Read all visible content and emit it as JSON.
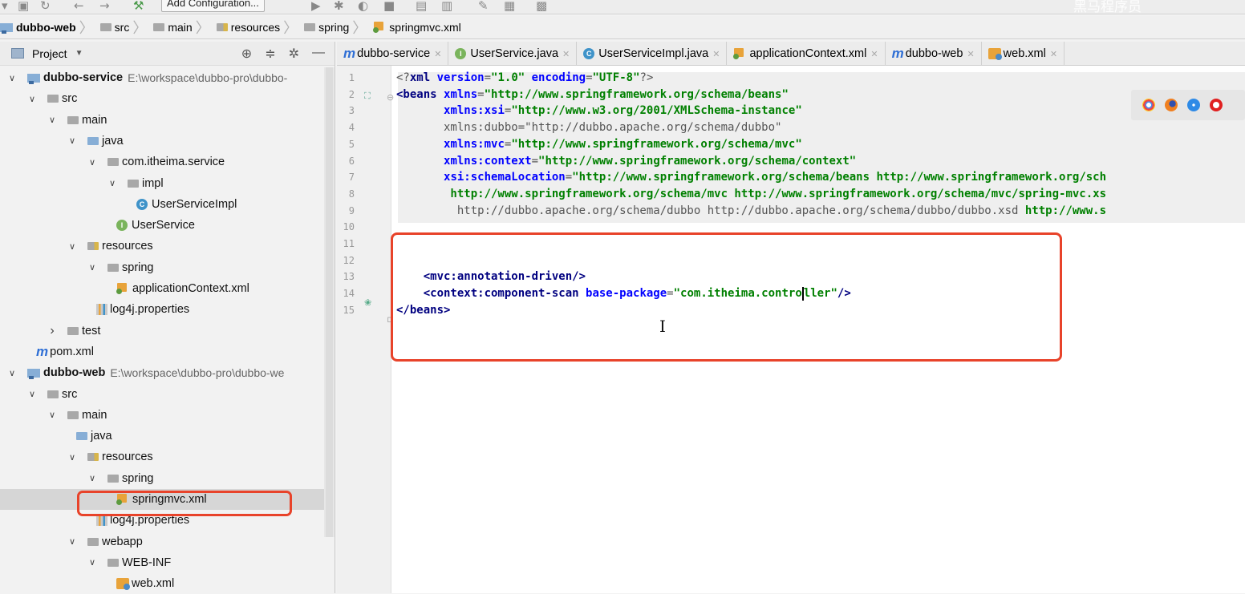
{
  "toolbar": {
    "run_config": "Add Configuration...",
    "right_watermark": "黑马程序员"
  },
  "breadcrumb": [
    {
      "label": "dubbo-web",
      "kind": "module"
    },
    {
      "label": "src",
      "kind": "folder"
    },
    {
      "label": "main",
      "kind": "folder"
    },
    {
      "label": "resources",
      "kind": "res-folder"
    },
    {
      "label": "spring",
      "kind": "folder"
    },
    {
      "label": "springmvc.xml",
      "kind": "xml"
    }
  ],
  "project": {
    "title": "Project",
    "tree": [
      {
        "label": "dubbo-service",
        "path": "E:\\workspace\\dubbo-pro\\dubbo-",
        "indent": 0,
        "arrow": "down",
        "icon": "module",
        "bold": true
      },
      {
        "label": "src",
        "indent": 1,
        "arrow": "down",
        "icon": "folder"
      },
      {
        "label": "main",
        "indent": 2,
        "arrow": "down",
        "icon": "folder"
      },
      {
        "label": "java",
        "indent": 3,
        "arrow": "down",
        "icon": "folder-blue"
      },
      {
        "label": "com.itheima.service",
        "indent": 4,
        "arrow": "down",
        "icon": "package"
      },
      {
        "label": "impl",
        "indent": 5,
        "arrow": "down",
        "icon": "package"
      },
      {
        "label": "UserServiceImpl",
        "indent": 6,
        "arrow": "",
        "icon": "class"
      },
      {
        "label": "UserService",
        "indent": 5,
        "arrow": "",
        "icon": "interface"
      },
      {
        "label": "resources",
        "indent": 3,
        "arrow": "down",
        "icon": "res-folder"
      },
      {
        "label": "spring",
        "indent": 4,
        "arrow": "down",
        "icon": "package"
      },
      {
        "label": "applicationContext.xml",
        "indent": 5,
        "arrow": "",
        "icon": "xml"
      },
      {
        "label": "log4j.properties",
        "indent": 4,
        "arrow": "",
        "icon": "properties"
      },
      {
        "label": "test",
        "indent": 2,
        "arrow": "right",
        "icon": "folder"
      },
      {
        "label": "pom.xml",
        "indent": 1,
        "arrow": "",
        "icon": "maven"
      },
      {
        "label": "dubbo-web",
        "path": "E:\\workspace\\dubbo-pro\\dubbo-we",
        "indent": 0,
        "arrow": "down",
        "icon": "module",
        "bold": true
      },
      {
        "label": "src",
        "indent": 1,
        "arrow": "down",
        "icon": "folder"
      },
      {
        "label": "main",
        "indent": 2,
        "arrow": "down",
        "icon": "folder"
      },
      {
        "label": "java",
        "indent": 3,
        "arrow": "",
        "icon": "folder-blue"
      },
      {
        "label": "resources",
        "indent": 3,
        "arrow": "down",
        "icon": "res-folder"
      },
      {
        "label": "spring",
        "indent": 4,
        "arrow": "down",
        "icon": "package"
      },
      {
        "label": "springmvc.xml",
        "indent": 5,
        "arrow": "",
        "icon": "xml",
        "selected": true
      },
      {
        "label": "log4j.properties",
        "indent": 4,
        "arrow": "",
        "icon": "properties"
      },
      {
        "label": "webapp",
        "indent": 3,
        "arrow": "down",
        "icon": "folder"
      },
      {
        "label": "WEB-INF",
        "indent": 4,
        "arrow": "down",
        "icon": "folder"
      },
      {
        "label": "web.xml",
        "indent": 5,
        "arrow": "",
        "icon": "webxml"
      }
    ]
  },
  "tabs": [
    {
      "label": "dubbo-service",
      "icon": "maven"
    },
    {
      "label": "UserService.java",
      "icon": "interface"
    },
    {
      "label": "UserServiceImpl.java",
      "icon": "class"
    },
    {
      "label": "applicationContext.xml",
      "icon": "xml"
    },
    {
      "label": "dubbo-web",
      "icon": "maven"
    },
    {
      "label": "web.xml",
      "icon": "webxml"
    }
  ],
  "editor": {
    "lines": [
      {
        "n": "1",
        "segs": [
          [
            "g",
            "<?"
          ],
          [
            "k",
            "xml "
          ],
          [
            "a",
            "version"
          ],
          [
            "g",
            "="
          ],
          [
            "v",
            "\"1.0\""
          ],
          [
            "g",
            " "
          ],
          [
            "a",
            "encoding"
          ],
          [
            "g",
            "="
          ],
          [
            "v",
            "\"UTF-8\""
          ],
          [
            "g",
            "?>"
          ]
        ]
      },
      {
        "n": "2",
        "segs": [
          [
            "k",
            "<beans "
          ],
          [
            "a",
            "xmlns"
          ],
          [
            "g",
            "="
          ],
          [
            "v",
            "\"http://www.springframework.org/schema/beans\""
          ]
        ]
      },
      {
        "n": "3",
        "segs": [
          [
            "g",
            "       "
          ],
          [
            "a",
            "xmlns:xsi"
          ],
          [
            "g",
            "="
          ],
          [
            "v",
            "\"http://www.w3.org/2001/XMLSchema-instance\""
          ]
        ]
      },
      {
        "n": "4",
        "segs": [
          [
            "g",
            "       xmlns:dubbo=\"http://dubbo.apache.org/schema/dubbo\""
          ]
        ]
      },
      {
        "n": "5",
        "segs": [
          [
            "g",
            "       "
          ],
          [
            "a",
            "xmlns:mvc"
          ],
          [
            "g",
            "="
          ],
          [
            "v",
            "\"http://www.springframework.org/schema/mvc\""
          ]
        ]
      },
      {
        "n": "6",
        "segs": [
          [
            "g",
            "       "
          ],
          [
            "a",
            "xmlns:context"
          ],
          [
            "g",
            "="
          ],
          [
            "v",
            "\"http://www.springframework.org/schema/context\""
          ]
        ]
      },
      {
        "n": "7",
        "segs": [
          [
            "g",
            "       "
          ],
          [
            "a",
            "xsi:schemaLocation"
          ],
          [
            "g",
            "="
          ],
          [
            "v",
            "\"http://www.springframework.org/schema/beans http://www.springframework.org/sch"
          ]
        ]
      },
      {
        "n": "8",
        "segs": [
          [
            "v",
            "        http://www.springframework.org/schema/mvc http://www.springframework.org/schema/mvc/spring-mvc.xs"
          ]
        ]
      },
      {
        "n": "9",
        "segs": [
          [
            "g",
            "         http://dubbo.apache.org/schema/dubbo http://dubbo.apache.org/schema/dubbo/dubbo.xsd "
          ],
          [
            "v",
            "http://www.s"
          ]
        ]
      },
      {
        "n": "10",
        "segs": []
      },
      {
        "n": "11",
        "segs": []
      },
      {
        "n": "12",
        "segs": []
      },
      {
        "n": "13",
        "segs": [
          [
            "g",
            "    "
          ],
          [
            "k",
            "<mvc:annotation-driven"
          ],
          [
            "k",
            "/>"
          ]
        ]
      },
      {
        "n": "14",
        "segs": [
          [
            "g",
            "    "
          ],
          [
            "k",
            "<context:component-scan "
          ],
          [
            "a",
            "base-package"
          ],
          [
            "g",
            "="
          ],
          [
            "v",
            "\"com.itheima.contro"
          ],
          [
            "caret",
            ""
          ],
          [
            "v",
            "ller\""
          ],
          [
            "k",
            "/>"
          ]
        ]
      },
      {
        "n": "15",
        "segs": [
          [
            "k",
            "</beans>"
          ]
        ]
      }
    ]
  },
  "colors": {
    "highlight_box": "#e8432a",
    "selection": "#d6d6d6"
  }
}
